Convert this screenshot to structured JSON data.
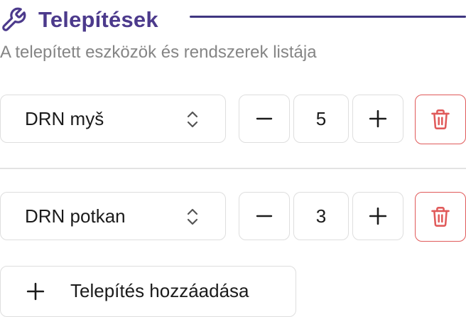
{
  "header": {
    "title": "Telepítések",
    "icon": "wrench-icon",
    "accent_color": "#4c3a8c"
  },
  "subtitle": "A telepített eszközök és rendszerek listája",
  "installations": [
    {
      "device": "DRN myš",
      "quantity": "5",
      "select_icon": "chevron-up-down-icon",
      "decrement_icon": "minus-icon",
      "increment_icon": "plus-icon",
      "delete_icon": "trash-icon"
    },
    {
      "device": "DRN potkan",
      "quantity": "3",
      "select_icon": "chevron-up-down-icon",
      "decrement_icon": "minus-icon",
      "increment_icon": "plus-icon",
      "delete_icon": "trash-icon"
    }
  ],
  "add_button": {
    "label": "Telepítés hozzáadása",
    "icon": "plus-icon"
  },
  "colors": {
    "delete": "#e05a5a",
    "border": "#dedede",
    "muted_text": "#858585"
  }
}
